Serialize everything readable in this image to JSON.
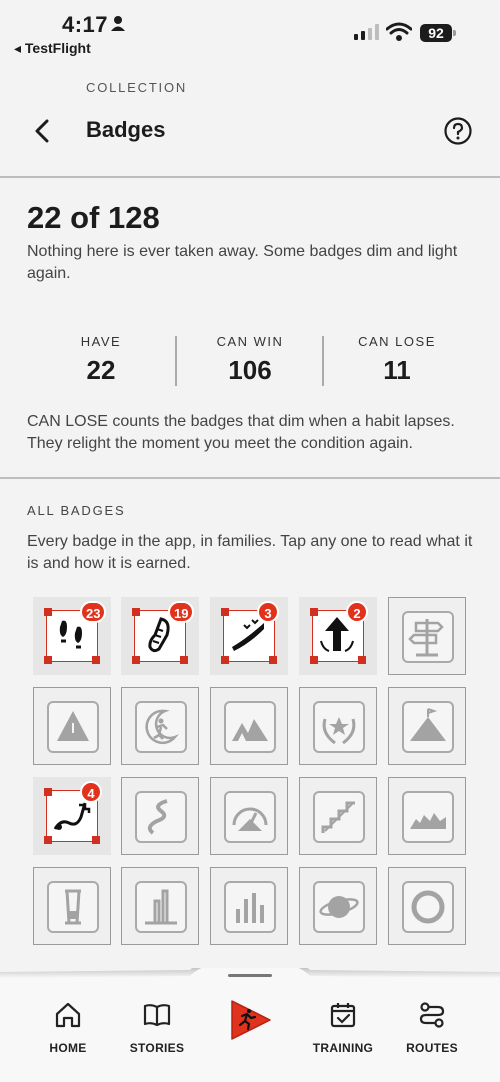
{
  "status_bar": {
    "time": "4:17",
    "back_app": "◂ TestFlight",
    "battery": "92"
  },
  "header": {
    "eyebrow": "COLLECTION",
    "title": "Badges"
  },
  "summary": {
    "headline": "22 of 128",
    "intro": "Nothing here is ever taken away. Some badges dim and light again.",
    "stats": [
      {
        "label": "HAVE",
        "value": "22"
      },
      {
        "label": "CAN WIN",
        "value": "106"
      },
      {
        "label": "CAN LOSE",
        "value": "11"
      }
    ],
    "note": "CAN LOSE counts the badges that dim when a habit lapses. They relight the moment you meet the condition again."
  },
  "all_badges": {
    "label": "ALL BADGES",
    "description": "Every badge in the app, in families. Tap any one to read what it is and how it is earned.",
    "rows": [
      [
        {
          "icon": "footprints-icon",
          "earned": true,
          "count": "23"
        },
        {
          "icon": "shoe-print-icon",
          "earned": true,
          "count": "19"
        },
        {
          "icon": "trail-birds-icon",
          "earned": true,
          "count": "3"
        },
        {
          "icon": "up-arrow-icon",
          "earned": true,
          "count": "2"
        },
        {
          "icon": "signpost-icon",
          "earned": false
        }
      ],
      [
        {
          "icon": "warning-triangle-icon",
          "earned": false
        },
        {
          "icon": "moon-runner-icon",
          "earned": false
        },
        {
          "icon": "mountains-icon",
          "earned": false
        },
        {
          "icon": "laurel-star-icon",
          "earned": false
        },
        {
          "icon": "summit-icon",
          "earned": false
        }
      ],
      [
        {
          "icon": "staircase-trail-icon",
          "earned": true,
          "count": "4"
        },
        {
          "icon": "winding-road-icon",
          "earned": false
        },
        {
          "icon": "speedometer-icon",
          "earned": false
        },
        {
          "icon": "stairs-icon",
          "earned": false
        },
        {
          "icon": "ridge-icon",
          "earned": false
        }
      ],
      [
        {
          "icon": "pillar-icon",
          "earned": false
        },
        {
          "icon": "city-towers-icon",
          "earned": false
        },
        {
          "icon": "bars-icon",
          "earned": false
        },
        {
          "icon": "planet-icon",
          "earned": false
        },
        {
          "icon": "ring-icon",
          "earned": false
        }
      ]
    ]
  },
  "tab_bar": {
    "tabs": [
      {
        "label": "HOME",
        "icon": "home-icon"
      },
      {
        "label": "STORIES",
        "icon": "book-icon"
      },
      {
        "label": "",
        "icon": "runner-icon"
      },
      {
        "label": "TRAINING",
        "icon": "calendar-check-icon"
      },
      {
        "label": "ROUTES",
        "icon": "route-icon"
      }
    ]
  },
  "colors": {
    "accent": "#d0301f",
    "badge_count": "#e0321c",
    "background": "#f3f3f3"
  }
}
